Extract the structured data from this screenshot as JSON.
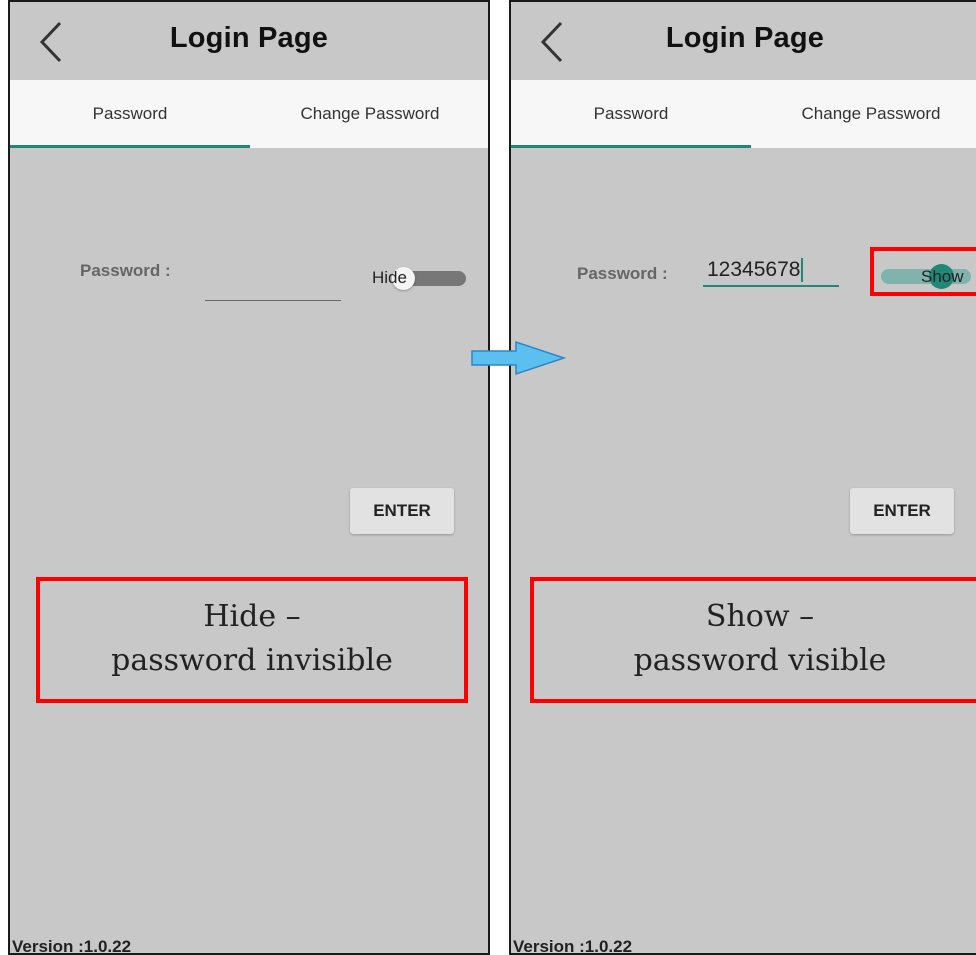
{
  "header": {
    "title": "Login Page"
  },
  "tabs": [
    {
      "label": "Password"
    },
    {
      "label": "Change Password"
    }
  ],
  "form": {
    "password_label": "Password :",
    "left_value": "",
    "right_value": "12345678",
    "enter_label": "ENTER"
  },
  "toggles": {
    "left_label": "Hide",
    "right_label": "Show"
  },
  "callouts": {
    "left_line1": "Hide –",
    "left_line2": "password invisible",
    "right_line1": "Show –",
    "right_line2": "password visible"
  },
  "footer": {
    "version": "Version :1.0.22"
  },
  "colors": {
    "accent": "#1f8878",
    "highlight": "#ff0000",
    "arrow": "#5bc0f0",
    "background": "#c8c8c8"
  },
  "icons": {
    "back": "chevron-left-icon",
    "arrow": "arrow-right-icon"
  }
}
